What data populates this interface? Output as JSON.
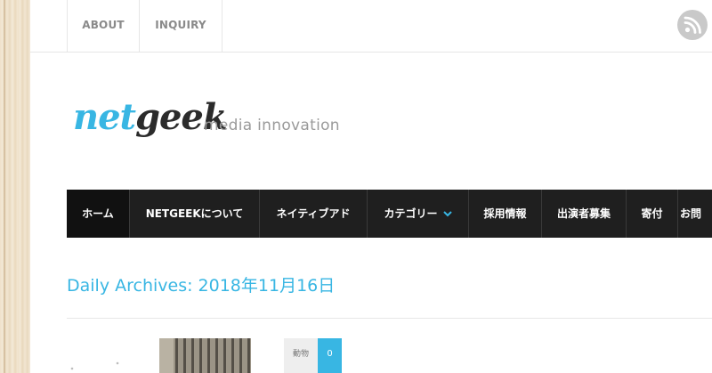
{
  "topbar": {
    "links": [
      "ABOUT",
      "INQUIRY"
    ],
    "rss_icon": "rss-icon"
  },
  "branding": {
    "logo_net": "net",
    "logo_geek": "geek",
    "tagline": "media innovation"
  },
  "nav": {
    "items": [
      {
        "label": "ホーム",
        "active": true
      },
      {
        "label": "NETGEEKについて"
      },
      {
        "label": "ネイティブアド"
      },
      {
        "label": "カテゴリー",
        "has_dropdown": true
      },
      {
        "label": "採用情報"
      },
      {
        "label": "出演者募集"
      },
      {
        "label": "寄付"
      },
      {
        "label": "お問"
      }
    ],
    "dropdown_icon": "chevron-down-icon"
  },
  "archive": {
    "title": "Daily Archives: 2018年11月16日"
  },
  "post": {
    "category": "動物",
    "count": "0"
  },
  "colors": {
    "accent": "#38b6e3",
    "nav_bg": "#1f1f1f",
    "logo_dark": "#2b2b2b"
  }
}
